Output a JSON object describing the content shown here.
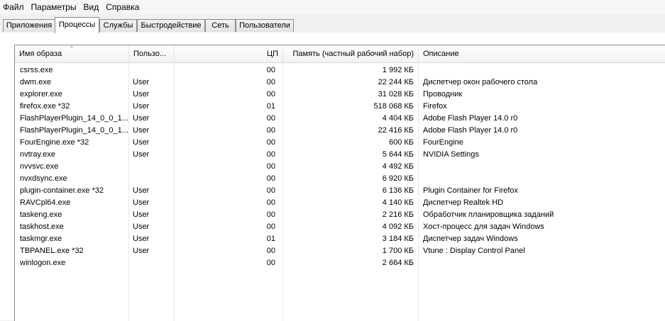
{
  "menu": [
    "Файл",
    "Параметры",
    "Вид",
    "Справка"
  ],
  "tabs": [
    {
      "label": "Приложения",
      "active": false
    },
    {
      "label": "Процессы",
      "active": true
    },
    {
      "label": "Службы",
      "active": false
    },
    {
      "label": "Быстродействие",
      "active": false
    },
    {
      "label": "Сеть",
      "active": false
    },
    {
      "label": "Пользователи",
      "active": false
    }
  ],
  "columns": {
    "name": "Имя образа",
    "user": "Пользо...",
    "cpu": "ЦП",
    "memory": "Память (частный рабочий набор)",
    "description": "Описание",
    "sort_indicator": "˄"
  },
  "processes": [
    {
      "name": "csrss.exe",
      "user": "",
      "cpu": "00",
      "memory": "1 992 КБ",
      "description": ""
    },
    {
      "name": "dwm.exe",
      "user": "User",
      "cpu": "00",
      "memory": "22 244 КБ",
      "description": "Диспетчер окон рабочего стола"
    },
    {
      "name": "explorer.exe",
      "user": "User",
      "cpu": "00",
      "memory": "31 028 КБ",
      "description": "Проводник"
    },
    {
      "name": "firefox.exe *32",
      "user": "User",
      "cpu": "01",
      "memory": "518 068 КБ",
      "description": "Firefox"
    },
    {
      "name": "FlashPlayerPlugin_14_0_0_1...",
      "user": "User",
      "cpu": "00",
      "memory": "4 404 КБ",
      "description": "Adobe Flash Player 14.0 r0"
    },
    {
      "name": "FlashPlayerPlugin_14_0_0_1...",
      "user": "User",
      "cpu": "00",
      "memory": "22 416 КБ",
      "description": "Adobe Flash Player 14.0 r0"
    },
    {
      "name": "FourEngine.exe *32",
      "user": "User",
      "cpu": "00",
      "memory": "600 КБ",
      "description": "FourEngine"
    },
    {
      "name": "nvtray.exe",
      "user": "User",
      "cpu": "00",
      "memory": "5 644 КБ",
      "description": "NVIDIA Settings"
    },
    {
      "name": "nvvsvc.exe",
      "user": "",
      "cpu": "00",
      "memory": "4 492 КБ",
      "description": ""
    },
    {
      "name": "nvxdsync.exe",
      "user": "",
      "cpu": "00",
      "memory": "6 920 КБ",
      "description": ""
    },
    {
      "name": "plugin-container.exe *32",
      "user": "User",
      "cpu": "00",
      "memory": "6 136 КБ",
      "description": "Plugin Container for Firefox"
    },
    {
      "name": "RAVCpl64.exe",
      "user": "User",
      "cpu": "00",
      "memory": "4 140 КБ",
      "description": "Диспетчер Realtek HD"
    },
    {
      "name": "taskeng.exe",
      "user": "User",
      "cpu": "00",
      "memory": "2 216 КБ",
      "description": "Обработчик планировщика заданий"
    },
    {
      "name": "taskhost.exe",
      "user": "User",
      "cpu": "00",
      "memory": "4 092 КБ",
      "description": "Хост-процесс для задач Windows"
    },
    {
      "name": "taskmgr.exe",
      "user": "User",
      "cpu": "01",
      "memory": "3 184 КБ",
      "description": "Диспетчер задач Windows"
    },
    {
      "name": "TBPANEL.exe *32",
      "user": "User",
      "cpu": "00",
      "memory": "1 700 КБ",
      "description": "Vtune : Display Control Panel"
    },
    {
      "name": "winlogon.exe",
      "user": "",
      "cpu": "00",
      "memory": "2 664 КБ",
      "description": ""
    }
  ]
}
